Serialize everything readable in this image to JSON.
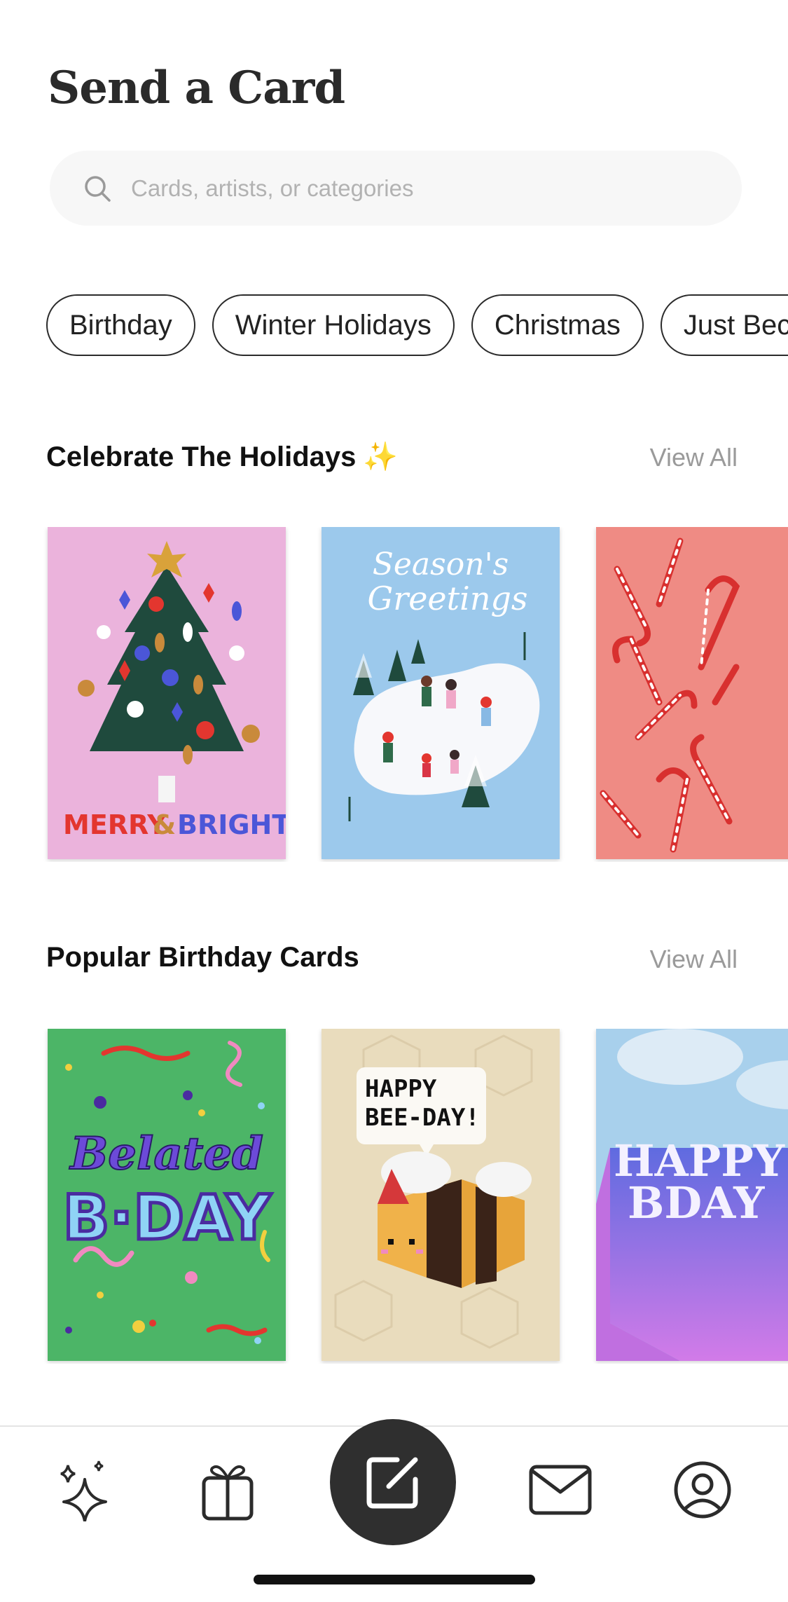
{
  "header": {
    "title": "Send a Card"
  },
  "search": {
    "placeholder": "Cards, artists, or categories"
  },
  "chips": [
    "Birthday",
    "Winter Holidays",
    "Christmas",
    "Just Because"
  ],
  "sections": [
    {
      "title": "Celebrate The Holidays",
      "emoji": "✨",
      "view_all": "View All",
      "cards": [
        {
          "name": "merry-and-bright-card",
          "text_left": "MERRY",
          "text_amp": "&",
          "text_right": "BRIGHT"
        },
        {
          "name": "seasons-greetings-card",
          "text_line1": "Season's",
          "text_line2": "Greetings"
        },
        {
          "name": "candy-cane-card"
        }
      ]
    },
    {
      "title": "Popular Birthday Cards",
      "view_all": "View All",
      "cards": [
        {
          "name": "belated-bday-card",
          "text_line1": "Belated",
          "text_line2": "B·DAY"
        },
        {
          "name": "happy-bee-day-card",
          "text_line1": "HAPPY",
          "text_line2": "BEE-DAY!"
        },
        {
          "name": "happy-bday-card",
          "text_line1": "HAPPY",
          "text_line2": "BDAY"
        }
      ]
    }
  ],
  "tabbar": {
    "items": [
      {
        "name": "discover",
        "icon": "sparkles-icon"
      },
      {
        "name": "gifts",
        "icon": "gift-icon"
      },
      {
        "name": "compose",
        "icon": "compose-icon"
      },
      {
        "name": "inbox",
        "icon": "envelope-icon"
      },
      {
        "name": "profile",
        "icon": "profile-icon"
      }
    ]
  }
}
